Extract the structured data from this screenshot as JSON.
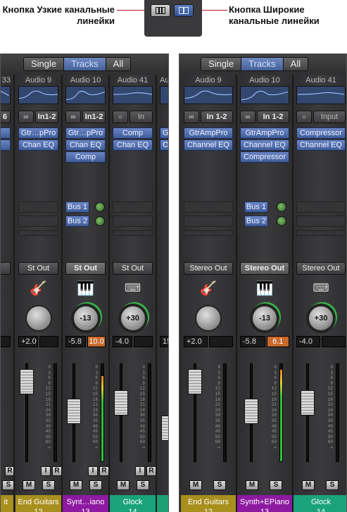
{
  "callouts": {
    "narrow": "Кнопка Узкие канальные линейки",
    "wide": "Кнопка Широкие канальные линейки"
  },
  "filter": {
    "single": "Single",
    "tracks": "Tracks",
    "all": "All"
  },
  "narrow_panel": {
    "strips": [
      {
        "name": "33",
        "input": "6",
        "output": "",
        "pan": "",
        "gain": "",
        "label": "it",
        "number": ""
      },
      {
        "name": "Audio 9",
        "input": "In1-2",
        "plugins": [
          "Gtr…pPro",
          "Chan EQ"
        ],
        "output": "St Out",
        "icon": "guitar-icon",
        "gain": "+2.0",
        "peak": "",
        "label": "End Guitars",
        "number": "12"
      },
      {
        "name": "Audio 10",
        "input": "In1-2",
        "plugins": [
          "Gtr…pPro",
          "Chan EQ",
          "Comp"
        ],
        "sends": [
          "Bus 1",
          "Bus 2"
        ],
        "output": "St Out",
        "icon": "synth-icon",
        "pan": "-13",
        "gain": "-5.8",
        "peak": "10.0",
        "label": "Synt…iano",
        "number": "13"
      },
      {
        "name": "Audio 41",
        "input": "In",
        "plugins": [
          "Comp",
          "Chan EQ"
        ],
        "output": "St Out",
        "icon": "keyboard-icon",
        "pan": "+30",
        "gain": "-4.0",
        "peak": "",
        "label": "Glock",
        "number": "14"
      },
      {
        "name": "Au",
        "input": "",
        "plugins": [
          "G",
          "C"
        ],
        "output": "",
        "gain": "15",
        "label": "",
        "number": ""
      }
    ]
  },
  "wide_panel": {
    "strips": [
      {
        "name": "Audio 9",
        "input": "In 1-2",
        "plugins": [
          "GtrAmpPro",
          "Channel EQ"
        ],
        "output": "Stereo Out",
        "gain": "+2.0",
        "peak": "",
        "label": "End Guitars",
        "number": "12"
      },
      {
        "name": "Audio 10",
        "input": "In 1-2",
        "plugins": [
          "GtrAmpPro",
          "Channel EQ",
          "Compressor"
        ],
        "sends": [
          "Bus 1",
          "Bus 2"
        ],
        "output": "Stereo Out",
        "pan": "-13",
        "gain": "-5.8",
        "peak": "6.1",
        "label": "Synth+EPiano",
        "number": "13"
      },
      {
        "name": "Audio 41",
        "input": "Input",
        "plugins": [
          "Compressor",
          "Channel EQ"
        ],
        "output": "Stereo Out",
        "pan": "+30",
        "gain": "-4.0",
        "peak": "",
        "label": "Glock",
        "number": "14"
      }
    ]
  },
  "fader_scale": [
    "0",
    "3",
    "6",
    "9",
    "12",
    "15",
    "18",
    "21",
    "24",
    "30",
    "35",
    "40",
    "45",
    "50",
    "60",
    "∞"
  ],
  "buttons": {
    "input_monitor": "I",
    "record": "R",
    "mute": "M",
    "solo": "S"
  },
  "colors": {
    "gold": "#a88f1e",
    "purple": "#8d1aa0",
    "green": "#1aa37a",
    "blue_plugin": "#5673b0"
  }
}
